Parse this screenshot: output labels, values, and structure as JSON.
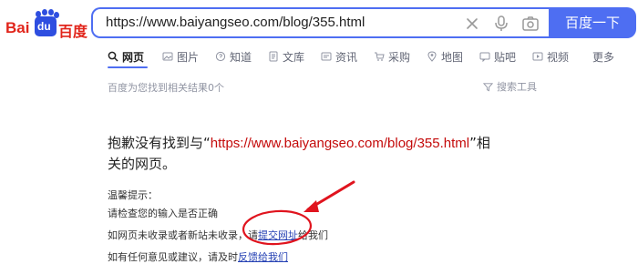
{
  "logo": {
    "bai": "Bai",
    "du": "du",
    "cn": "百度"
  },
  "search": {
    "value": "https://www.baiyangseo.com/blog/355.html",
    "button_label": "百度一下"
  },
  "tabs": [
    {
      "label": "网页",
      "icon": "search-icon",
      "active": true
    },
    {
      "label": "图片",
      "icon": "image-icon"
    },
    {
      "label": "知道",
      "icon": "question-icon"
    },
    {
      "label": "文库",
      "icon": "document-icon"
    },
    {
      "label": "资讯",
      "icon": "news-icon"
    },
    {
      "label": "采购",
      "icon": "cart-icon"
    },
    {
      "label": "地图",
      "icon": "map-pin-icon"
    },
    {
      "label": "贴吧",
      "icon": "forum-icon"
    },
    {
      "label": "视频",
      "icon": "video-icon"
    },
    {
      "label": "更多"
    }
  ],
  "result_count": "百度为您找到相关结果0个",
  "search_tools": "搜索工具",
  "not_found": {
    "prefix": "抱歉没有找到与“",
    "url": "https://www.baiyangseo.com/blog/355.html",
    "suffix": "”相关的网页。"
  },
  "tips": {
    "title": "温馨提示：",
    "line1": "请检查您的输入是否正确",
    "line2_prefix": "如网页未收录或者新站未收录，请",
    "line2_link": "提交网址",
    "line2_suffix": "给我们",
    "line3_prefix": "如有任何意见或建议，请及时",
    "line3_link": "反馈给我们"
  },
  "colors": {
    "accent": "#4e6ef2",
    "logo_red": "#e1251b",
    "link": "#2440b3",
    "annotation_red": "#e0141e"
  }
}
